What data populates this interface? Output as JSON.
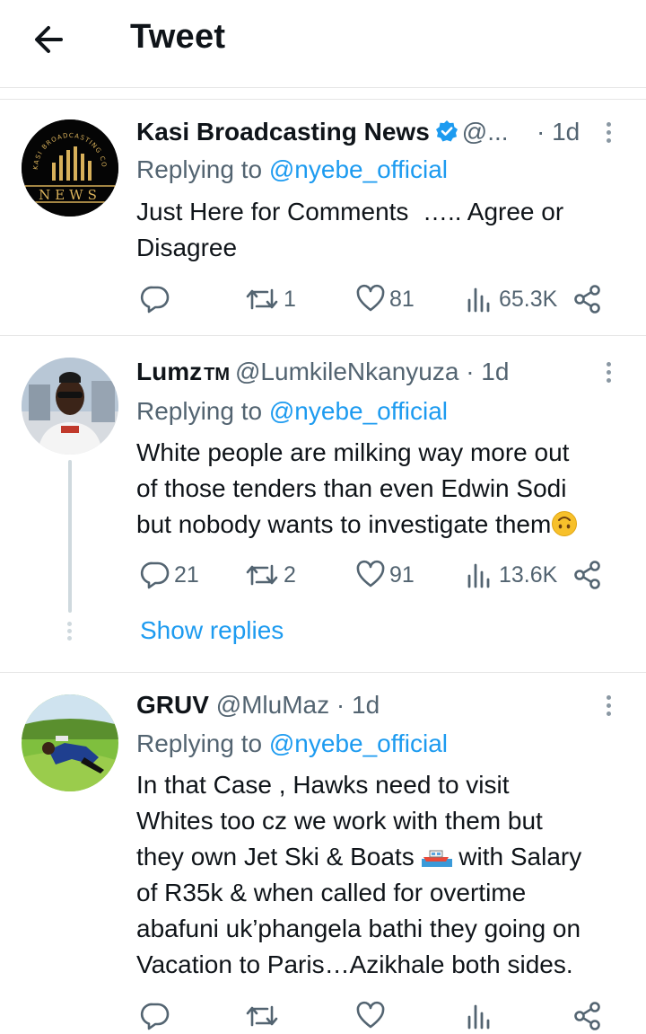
{
  "header": {
    "title": "Tweet"
  },
  "tweets": [
    {
      "name": "Kasi Broadcasting News",
      "handle": "@...",
      "time": "· 1d",
      "replying_label": "Replying to ",
      "replying_handle": "@nyebe_official",
      "body": "Just Here for Comments  ….. Agree or\nDisagree",
      "replies": "",
      "retweets": "1",
      "likes": "81",
      "views": "65.3K",
      "avatar_text_top": "KASI BROADCASTING CORPORATION",
      "avatar_text_bottom": "NEWS"
    },
    {
      "name": "Lumz",
      "badge": "TM",
      "handle": "@LumkileNkanyuza",
      "time": "· 1d",
      "replying_label": "Replying to ",
      "replying_handle": "@nyebe_official",
      "body_line1": "White people are milking way more out",
      "body_line2": "of those tenders than even Edwin Sodi",
      "body_line3": "but nobody wants to investigate them",
      "replies": "21",
      "retweets": "2",
      "likes": "91",
      "views": "13.6K",
      "show_replies": "Show replies"
    },
    {
      "name": "GRUV",
      "handle": "@MluMaz",
      "time": "· 1d",
      "replying_label": "Replying to ",
      "replying_handle": "@nyebe_official",
      "body_line1": "In that Case , Hawks need to visit",
      "body_line2": "Whites too cz we work with them but",
      "body_line3a": "they own Jet Ski & Boats ",
      "body_line3b": " with Salary",
      "body_line4": "of R35k & when called for overtime",
      "body_line5": "abafuni uk’phangela bathi they going on",
      "body_line6": "Vacation to Paris…Azikhale both sides."
    }
  ],
  "colors": {
    "link": "#1d9bf0",
    "muted": "#536471",
    "divider": "#e6e6e6"
  },
  "icons": [
    "back-arrow-icon",
    "verified-badge-icon",
    "more-icon",
    "reply-icon",
    "retweet-icon",
    "like-icon",
    "views-icon",
    "share-icon"
  ]
}
